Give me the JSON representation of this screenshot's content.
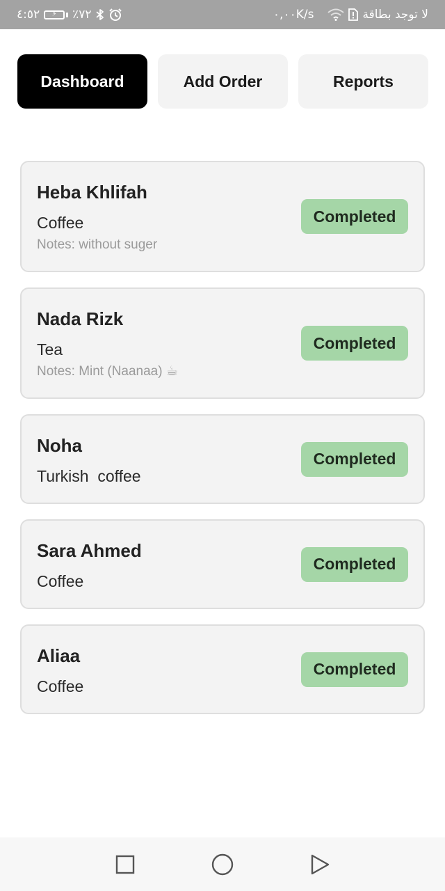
{
  "status_bar": {
    "time": "٤:٥٢",
    "battery_percent": "٪٧٢",
    "speed": "٠,٠٠K/s",
    "carrier": "لا توجد بطاقة",
    "icons": [
      "bluetooth-icon",
      "alarm-icon",
      "wifi-icon",
      "no-sim-icon",
      "battery-charging-icon"
    ]
  },
  "tabs": [
    {
      "label": "Dashboard",
      "active": true
    },
    {
      "label": "Add Order",
      "active": false
    },
    {
      "label": "Reports",
      "active": false
    }
  ],
  "orders": [
    {
      "name": "Heba Khlifah",
      "item": "Coffee",
      "notes": "Notes: without suger",
      "status": "Completed"
    },
    {
      "name": "Nada Rizk",
      "item": "Tea",
      "notes": "Notes: Mint (Naanaa) ☕",
      "status": "Completed"
    },
    {
      "name": "Noha",
      "item": "Turkish  coffee",
      "notes": "",
      "status": "Completed"
    },
    {
      "name": "Sara Ahmed",
      "item": "Coffee",
      "notes": "",
      "status": "Completed"
    },
    {
      "name": "Aliaa",
      "item": "Coffee",
      "notes": "",
      "status": "Completed"
    }
  ],
  "nav_bar": {
    "buttons": [
      "recents-square-icon",
      "home-circle-icon",
      "back-triangle-icon"
    ]
  },
  "colors": {
    "status_bar_bg": "#a3a3a3",
    "tab_active_bg": "#000000",
    "tab_inactive_bg": "#f3f3f3",
    "card_bg": "#f3f3f3",
    "badge_completed_bg": "#a5d6a7"
  }
}
